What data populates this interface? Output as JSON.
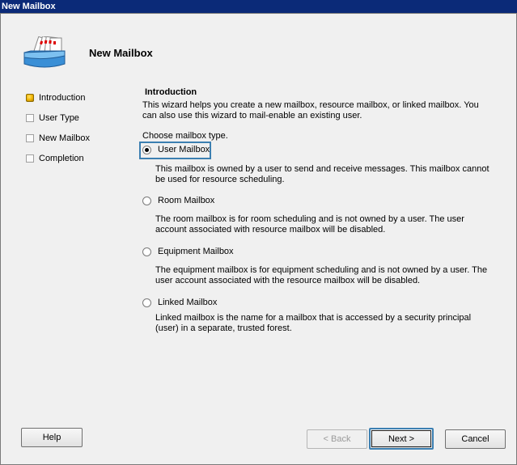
{
  "window": {
    "title": "New Mailbox"
  },
  "header": {
    "title": "New Mailbox",
    "icon": "mailbox-wizard-icon"
  },
  "steps": [
    {
      "label": "Introduction",
      "active": true
    },
    {
      "label": "User Type",
      "active": false
    },
    {
      "label": "New Mailbox",
      "active": false
    },
    {
      "label": "Completion",
      "active": false
    }
  ],
  "content": {
    "section_title": "Introduction",
    "intro": "This wizard helps you create a new mailbox, resource mailbox, or linked mailbox. You can also use this wizard to mail-enable an existing user.",
    "choose_label": "Choose mailbox type.",
    "options": [
      {
        "label": "User Mailbox",
        "checked": true,
        "description": "This mailbox is owned by a user to send and receive messages. This mailbox cannot be used for resource scheduling."
      },
      {
        "label": "Room Mailbox",
        "checked": false,
        "description": "The room mailbox is for room scheduling and is not owned by a user. The user account associated with resource mailbox will be disabled."
      },
      {
        "label": "Equipment Mailbox",
        "checked": false,
        "description": "The equipment mailbox is for equipment scheduling and is not owned by a user. The user account associated with the resource mailbox will be disabled."
      },
      {
        "label": "Linked Mailbox",
        "checked": false,
        "description": "Linked mailbox is the name for a mailbox that is accessed by a security principal (user) in a separate, trusted forest."
      }
    ]
  },
  "buttons": {
    "help": "Help",
    "back": "< Back",
    "next": "Next >",
    "cancel": "Cancel"
  },
  "colors": {
    "titlebar": "#0b2a78",
    "focus": "#3c7fb1",
    "step_active": "#f0b400"
  }
}
